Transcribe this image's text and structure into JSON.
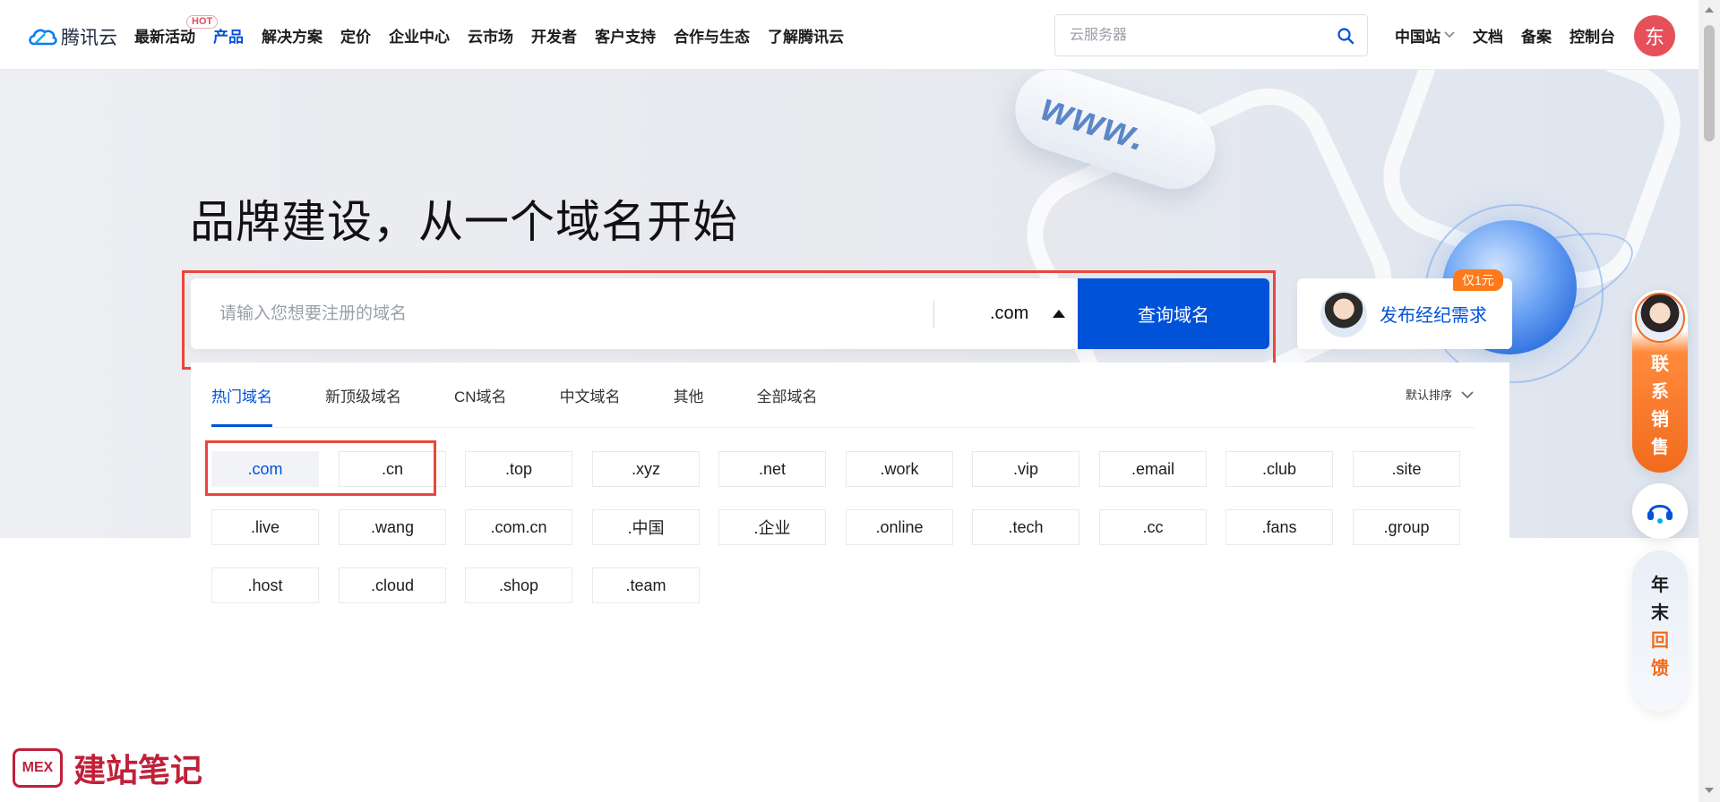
{
  "nav": {
    "logo_text": "腾讯云",
    "links": [
      "最新活动",
      "产品",
      "解决方案",
      "定价",
      "企业中心",
      "云市场",
      "开发者",
      "客户支持",
      "合作与生态",
      "了解腾讯云"
    ],
    "hot_badge": "HOT",
    "search_placeholder": "云服务器",
    "right_links": [
      "中国站",
      "文档",
      "备案",
      "控制台"
    ],
    "avatar_letter": "东"
  },
  "hero": {
    "title": "品牌建设，从一个域名开始",
    "deco_text": "www."
  },
  "domain_search": {
    "placeholder": "请输入您想要注册的域名",
    "tld": ".com",
    "query_label": "查询域名"
  },
  "broker": {
    "label": "发布经纪需求",
    "badge": "仅1元"
  },
  "panel": {
    "tabs": [
      "热门域名",
      "新顶级域名",
      "CN域名",
      "中文域名",
      "其他",
      "全部域名"
    ],
    "active_tab": "热门域名",
    "sort_label": "默认排序",
    "selected": [
      ".com"
    ],
    "rows": [
      [
        ".com",
        ".cn",
        ".top",
        ".xyz",
        ".net",
        ".work",
        ".vip",
        ".email",
        ".club",
        ".site"
      ],
      [
        ".live",
        ".wang",
        ".com.cn",
        ".中国",
        ".企业",
        ".online",
        ".tech",
        ".cc",
        ".fans",
        ".group"
      ],
      [
        ".host",
        ".cloud",
        ".shop",
        ".team"
      ]
    ]
  },
  "float": {
    "sales": [
      "联",
      "系",
      "销",
      "售"
    ],
    "year_end": [
      "年",
      "末",
      "回",
      "馈"
    ]
  },
  "watermark": {
    "logo": "MEX",
    "text": "建站笔记"
  },
  "colors": {
    "primary": "#0052d9",
    "highlight_frame": "#e8473b",
    "orange": "#f26b1d"
  }
}
